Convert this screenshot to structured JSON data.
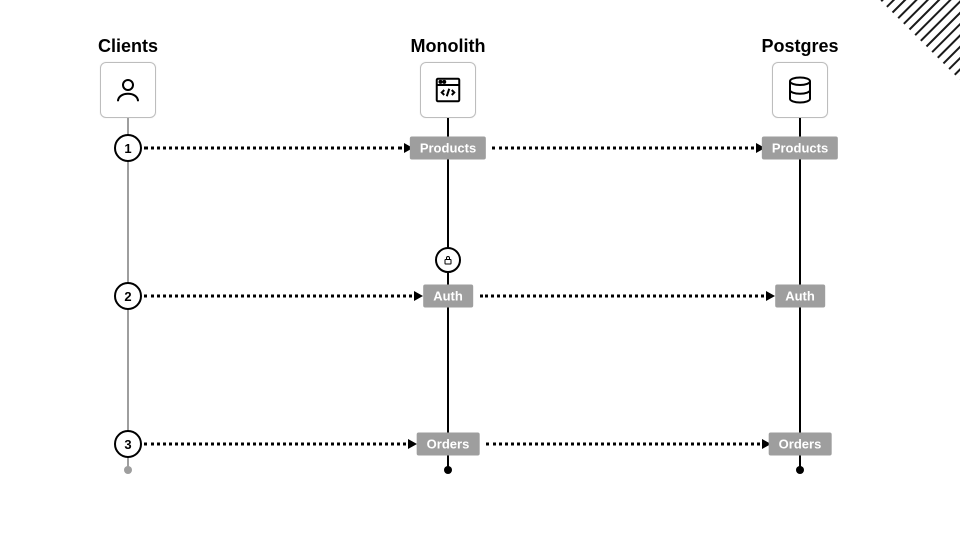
{
  "actors": {
    "clients": {
      "title": "Clients"
    },
    "monolith": {
      "title": "Monolith"
    },
    "postgres": {
      "title": "Postgres"
    }
  },
  "steps": {
    "s1": {
      "num": "1",
      "monolith_tag": "Products",
      "postgres_tag": "Products"
    },
    "s2": {
      "num": "2",
      "monolith_tag": "Auth",
      "postgres_tag": "Auth"
    },
    "s3": {
      "num": "3",
      "monolith_tag": "Orders",
      "postgres_tag": "Orders"
    }
  }
}
